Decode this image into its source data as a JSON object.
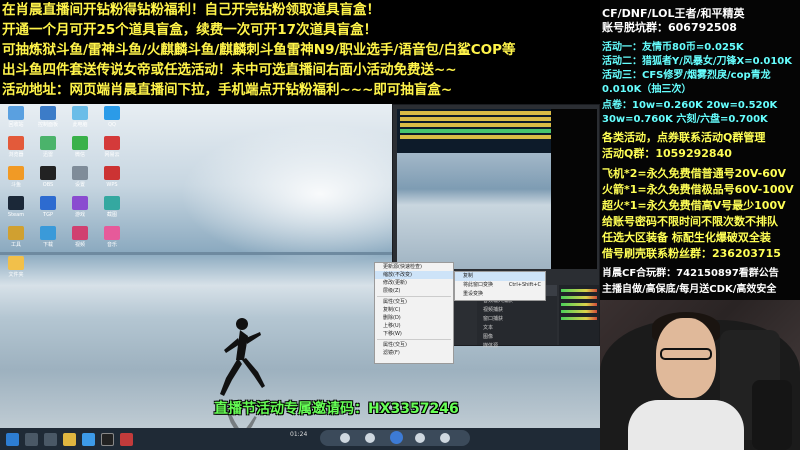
{
  "headline": {
    "lines": [
      {
        "text": "在肖晨直播间开钻粉得钻粉福利！自己开完钻粉领取道具盲盒！",
        "color": "yellow"
      },
      {
        "text": "开通一个月可开25个道具盲盒，续费一次可开17次道具盲盒！",
        "color": "yellow"
      },
      {
        "text": "可抽炼狱斗鱼/雷神斗鱼/火麒麟斗鱼/麒麟刺斗鱼雷神N9/职业选手/语音包/白鲨COP等",
        "color": "yellow"
      },
      {
        "text": "出斗鱼四件套送传说女帝或任选活动！未中可选直播间右面小活动免费送~~",
        "color": "yellow"
      },
      {
        "text": "活动地址：网页端肖晨直播间下拉，手机端点开钻粉福利~~~即可抽盲盒~",
        "color": "yellow"
      }
    ]
  },
  "invite": {
    "text": "直播节活动专属邀请码：HX3357246"
  },
  "right_panel": {
    "lines": [
      {
        "text": "CF/DNF/LOL王者/和平精英",
        "color": "wht",
        "size": 11
      },
      {
        "text": "账号脱坑群：606792508",
        "color": "wht",
        "size": 11
      },
      {
        "text": "活动一：友情币80币=0.025K",
        "color": "cyan",
        "size": 10
      },
      {
        "text": "活动二：猎狐者Y/风暴女/刀锋X=0.010K",
        "color": "cyan",
        "size": 10
      },
      {
        "text": "活动三：CFS修罗/烟雾烈戾/cop青龙",
        "color": "cyan",
        "size": 10
      },
      {
        "text": "    0.010K（抽三次）",
        "color": "cyan",
        "size": 10
      },
      {
        "text": "点卷：10w=0.260K   20w=0.520K",
        "color": "cyan",
        "size": 10
      },
      {
        "text": "  30w=0.760K  六刻/六盘=0.700K",
        "color": "cyan",
        "size": 10
      },
      {
        "text": "各类活动，点券联系活动Q群管理",
        "color": "yel",
        "size": 11
      },
      {
        "text": "活动Q群：1059292840",
        "color": "yel",
        "size": 11
      },
      {
        "text": "飞机*2=永久免费借普通号20V-60V",
        "color": "yel",
        "size": 11
      },
      {
        "text": "火箭*1=永久免费借极品号60V-100V",
        "color": "yel",
        "size": 11
      },
      {
        "text": "超火*1=永久免费借高V号最少100V",
        "color": "yel",
        "size": 11
      },
      {
        "text": "给账号密码不限时间不限次数不排队",
        "color": "yel",
        "size": 11
      },
      {
        "text": "任选大区装备 标配生化爆破双全装",
        "color": "yel",
        "size": 11
      },
      {
        "text": "借号刷壳联系粉丝群：236203715",
        "color": "yel",
        "size": 11
      },
      {
        "text": "肖晨CF合玩群：742150897看群公告",
        "color": "wht",
        "size": 10
      },
      {
        "text": "主播自做/高保底/每月送CDK/高效安全",
        "color": "wht",
        "size": 10
      }
    ]
  },
  "context_menu": {
    "items": [
      "更新源(快速检查)",
      "缩放(不改变)",
      "修改(更新)",
      "层级(Z)",
      "",
      "属性(交互)",
      "复制(C)",
      "删除(D)",
      "上移(U)",
      "下移(W)",
      "",
      "属性(交互)",
      "滤镜(F)"
    ],
    "highlight_index": 1
  },
  "submenu": {
    "items": [
      {
        "label": "复制",
        "shortcut": ""
      },
      {
        "label": "将此窗口变换",
        "shortcut": "Ctrl+Shift+C"
      },
      {
        "label": "重设变换",
        "shortcut": ""
      }
    ]
  },
  "obs": {
    "scenes_title": "场景",
    "scenes": [
      "场景",
      "场景 2"
    ],
    "sources_title": "来源",
    "sources": [
      "音频输入捕获",
      "视频捕获",
      "窗口捕获",
      "文本",
      "图像",
      "媒体源"
    ],
    "mixer_title": "混音器"
  },
  "desktop": {
    "icons": [
      "回收站",
      "控制面板",
      "此电脑",
      "QQ",
      "浏览器",
      "迅雷",
      "微信",
      "网易云",
      "斗鱼",
      "OBS",
      "设置",
      "WPS",
      "Steam",
      "TGP",
      "游戏",
      "截图",
      "工具",
      "下载",
      "视频",
      "音乐",
      "文件夹"
    ]
  },
  "taskbar": {
    "time": "01:24"
  }
}
